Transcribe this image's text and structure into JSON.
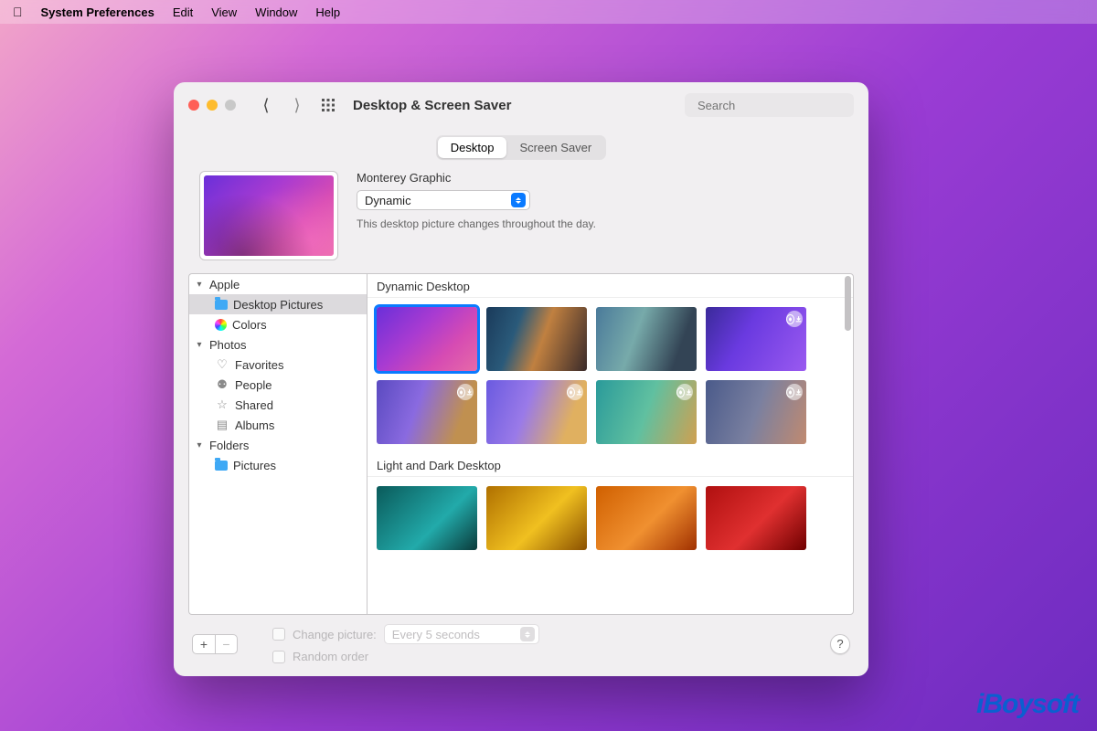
{
  "menubar": {
    "app": "System Preferences",
    "items": [
      "Edit",
      "View",
      "Window",
      "Help"
    ]
  },
  "window": {
    "title": "Desktop & Screen Saver",
    "search_placeholder": "Search"
  },
  "tabs": {
    "desktop": "Desktop",
    "screensaver": "Screen Saver"
  },
  "current": {
    "name": "Monterey Graphic",
    "mode": "Dynamic",
    "description": "This desktop picture changes throughout the day."
  },
  "sidebar": {
    "groups": [
      {
        "label": "Apple",
        "children": [
          {
            "label": "Desktop Pictures",
            "icon": "folder",
            "selected": true
          },
          {
            "label": "Colors",
            "icon": "colors"
          }
        ]
      },
      {
        "label": "Photos",
        "children": [
          {
            "label": "Favorites",
            "icon": "heart"
          },
          {
            "label": "People",
            "icon": "person"
          },
          {
            "label": "Shared",
            "icon": "shared"
          },
          {
            "label": "Albums",
            "icon": "albums"
          }
        ]
      },
      {
        "label": "Folders",
        "children": [
          {
            "label": "Pictures",
            "icon": "folder"
          }
        ]
      }
    ]
  },
  "gallery": {
    "sections": [
      {
        "title": "Dynamic Desktop"
      },
      {
        "title": "Light and Dark Desktop"
      }
    ]
  },
  "bottom": {
    "change_label": "Change picture:",
    "interval": "Every 5 seconds",
    "random_label": "Random order"
  },
  "watermark": "iBoysoft"
}
